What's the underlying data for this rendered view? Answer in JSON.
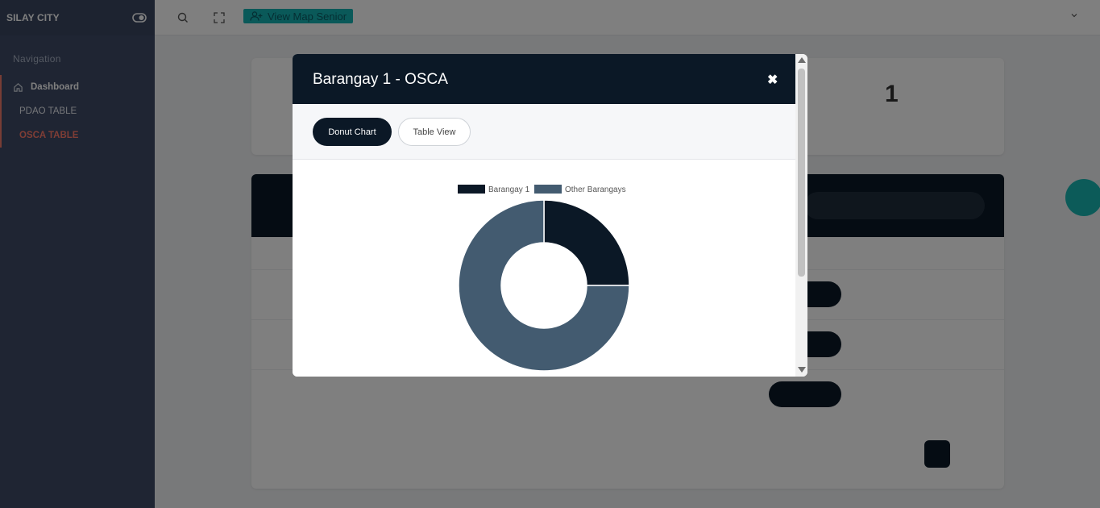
{
  "sidebar": {
    "brand": "SILAY CITY",
    "nav_heading": "Navigation",
    "items": [
      {
        "label": "Dashboard"
      },
      {
        "label": "PDAO TABLE"
      },
      {
        "label": "OSCA TABLE"
      }
    ]
  },
  "topbar": {
    "map_button_label": "View Map Senior"
  },
  "background": {
    "stat_number": "1"
  },
  "modal": {
    "title": "Barangay 1 - OSCA",
    "close_glyph": "✖",
    "tabs": [
      {
        "label": "Donut Chart"
      },
      {
        "label": "Table View"
      }
    ]
  },
  "colors": {
    "navy": "#0b1826",
    "slate": "#435b70",
    "teal": "#14b3b2",
    "accent": "#ff7a6a"
  },
  "chart_data": {
    "type": "pie",
    "variant": "donut",
    "labels": [
      "Barangay 1",
      "Other Barangays"
    ],
    "values": [
      25,
      75
    ],
    "colors": [
      "#0b1826",
      "#435b70"
    ],
    "legend": "top"
  }
}
